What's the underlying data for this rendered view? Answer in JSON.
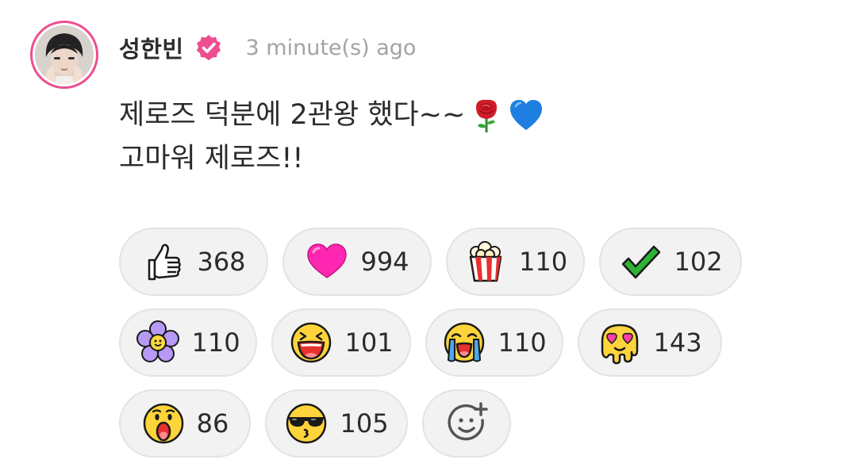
{
  "post": {
    "username": "성한빈",
    "timestamp": "3 minute(s) ago",
    "message_line1": "제로즈 덕분에 2관왕 했다~~",
    "message_line2": "고마워 제로즈!!",
    "message_emojis": [
      "rose-icon",
      "blue-heart-icon"
    ]
  },
  "reactions": [
    {
      "icon": "thumbs-up-icon",
      "count": "368"
    },
    {
      "icon": "pink-heart-icon",
      "count": "994"
    },
    {
      "icon": "popcorn-icon",
      "count": "110"
    },
    {
      "icon": "green-check-icon",
      "count": "102"
    },
    {
      "icon": "purple-flower-icon",
      "count": "110"
    },
    {
      "icon": "laughing-face-icon",
      "count": "101"
    },
    {
      "icon": "crying-face-icon",
      "count": "110"
    },
    {
      "icon": "melting-love-face-icon",
      "count": "143"
    },
    {
      "icon": "surprised-face-icon",
      "count": "86"
    },
    {
      "icon": "cool-kiss-face-icon",
      "count": "105"
    }
  ],
  "add_reaction_icon": "add-reaction-icon",
  "colors": {
    "accent": "#ee4d8f",
    "chip_bg": "#f2f2f2",
    "chip_border": "#e3e3e3",
    "timestamp": "#a3a3a3",
    "text": "#2b2b2b"
  }
}
